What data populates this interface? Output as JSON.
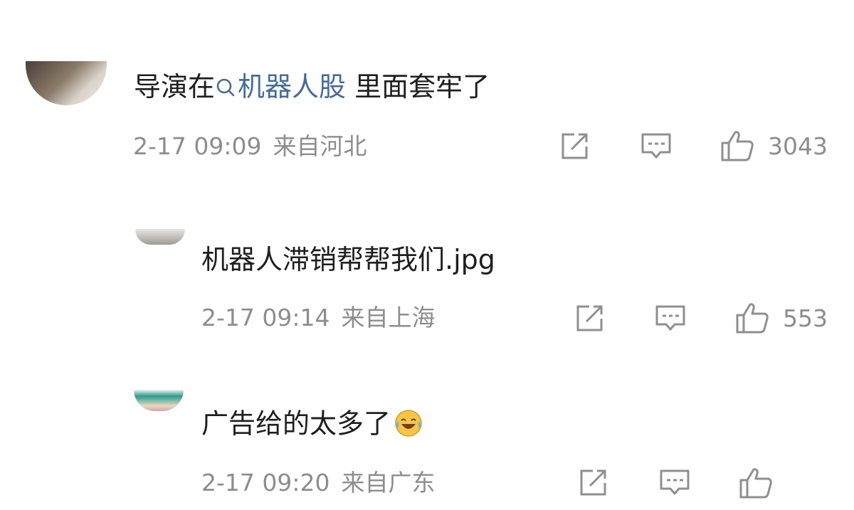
{
  "comments": [
    {
      "username": "",
      "text_before": "导演在",
      "topic": "机器人股",
      "text_after": "里面套牢了",
      "time": "2-17 09:09",
      "location": "来自河北",
      "likes": "3043"
    },
    {
      "username": "",
      "text": "机器人滞销帮帮我们.jpg",
      "time": "2-17 09:14",
      "location": "来自上海",
      "likes": "553"
    },
    {
      "username": "",
      "text": "广告给的太多了",
      "emoji": "crying-laughing-emoji",
      "time": "2-17 09:20",
      "location": "来自广东",
      "likes": ""
    }
  ],
  "icons": {
    "share": "share-icon",
    "comment": "comment-icon",
    "like": "thumbs-up-icon",
    "search": "search-icon"
  },
  "colors": {
    "topic_link": "#486b9a",
    "meta_text": "#8d8d8d",
    "body_text": "#1f1f1f"
  }
}
